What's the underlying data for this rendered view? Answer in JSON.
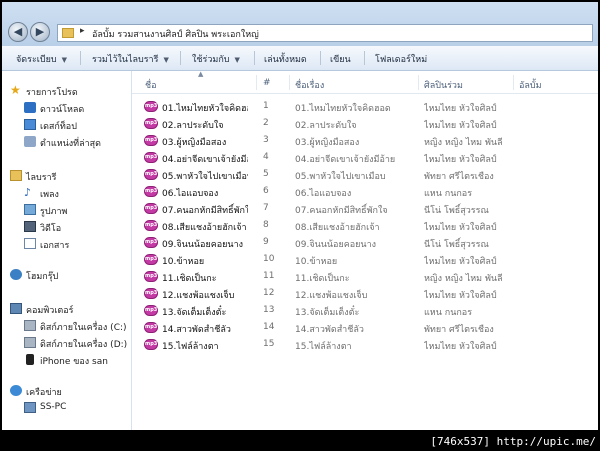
{
  "address": {
    "path": "อัลบั้ม รวมสานงานศิลป์ ศิลปิน พระเอกใหญ่"
  },
  "toolbar": {
    "organize": "จัดระเบียบ",
    "include_library": "รวมไว้ในไลบรารี",
    "share_with": "ใช้ร่วมกับ",
    "play_all": "เล่นทั้งหมด",
    "burn": "เขียน",
    "new_folder": "โฟลเดอร์ใหม่"
  },
  "nav": {
    "favorites": {
      "label": "รายการโปรด",
      "items": [
        "ดาวน์โหลด",
        "เดสก์ท็อป",
        "ตำแหน่งที่ล่าสุด"
      ]
    },
    "libraries": {
      "label": "ไลบรารี",
      "items": [
        "เพลง",
        "รูปภาพ",
        "วิดีโอ",
        "เอกสาร"
      ]
    },
    "homegroup": "โฮมกรุ๊ป",
    "computer": {
      "label": "คอมพิวเตอร์",
      "items": [
        "ดิสก์ภายในเครื่อง (C:)",
        "ดิสก์ภายในเครื่อง (D:)",
        "iPhone ของ san"
      ]
    },
    "network": {
      "label": "เครือข่าย",
      "items": [
        "SS-PC"
      ]
    }
  },
  "columns": {
    "name": "ชื่อ",
    "number": "#",
    "title": "ชื่อเรื่อง",
    "artist": "ศิลปินร่วม",
    "album": "อัลบั้ม"
  },
  "files": [
    {
      "name": "01.ไหมไทยหัวใจคิดฮอด",
      "num": "1",
      "title": "01.ไหมไทยหัวใจคิดฮอด",
      "artist": "ไหมไทย หัวใจศิลป์"
    },
    {
      "name": "02.ลาประดับใจ",
      "num": "2",
      "title": "02.ลาประดับใจ",
      "artist": "ไหมไทย หัวใจศิลป์"
    },
    {
      "name": "03.ผู้หญิงมือสอง",
      "num": "3",
      "title": "03.ผู้หญิงมือสอง",
      "artist": "หญิง หญิง ไหม พันลี"
    },
    {
      "name": "04.อย่าจีดเขาเจ้ายังมีอ้าย",
      "num": "4",
      "title": "04.อย่าจีดเขาเจ้ายังมีอ้าย",
      "artist": "ไหมไทย หัวใจศิลป์"
    },
    {
      "name": "05.พาหัวใจไปเขาเมือบ",
      "num": "5",
      "title": "05.พาหัวใจไปเขาเมือบ",
      "artist": "พัทยา ศรีไตรเชือง"
    },
    {
      "name": "06.ไอแอบจอง",
      "num": "6",
      "title": "06.ไอแอบจอง",
      "artist": "แหน กนกอร"
    },
    {
      "name": "07.คนอกหักมีสิทธิ์พักใจ",
      "num": "7",
      "title": "07.คนอกหักมีสิทธิ์พักใจ",
      "artist": "นีโน่ โพธิ์สุวรรณ"
    },
    {
      "name": "08.เสียแชงอ้ายฮักเจ้า",
      "num": "8",
      "title": "08.เสียแชงอ้ายฮักเจ้า",
      "artist": "ไหมไทย หัวใจศิลป์"
    },
    {
      "name": "09.จินนน้อยคอยนาง",
      "num": "9",
      "title": "09.จินนน้อยคอยนาง",
      "artist": "นีโน่ โพธิ์สุวรรณ"
    },
    {
      "name": "10.ข้าหอย",
      "num": "10",
      "title": "10.ข้าหอย",
      "artist": "ไหมไทย หัวใจศิลป์"
    },
    {
      "name": "11.เชิดเป็นกะ",
      "num": "11",
      "title": "11.เชิดเป็นกะ",
      "artist": "หญิง หญิง ไหม พันลี"
    },
    {
      "name": "12.แชงพ้อแชงเจ็บ",
      "num": "12",
      "title": "12.แชงพ้อแชงเจ็บ",
      "artist": "ไหมไทย หัวใจศิลป์"
    },
    {
      "name": "13.จัดเต็มเต็งตั๋ะ",
      "num": "13",
      "title": "13.จัดเต็มเต็งตั๋ะ",
      "artist": "แหน กนกอร"
    },
    {
      "name": "14.สาวพัดสำชีลัว",
      "num": "14",
      "title": "14.สาวพัดสำชีลัว",
      "artist": "พัทยา ศรีไตรเชือง"
    },
    {
      "name": "15.ไฟล์ล้างตา",
      "num": "15",
      "title": "15.ไฟล์ล้างตา",
      "artist": "ไหมไทย หัวใจศิลป์"
    }
  ],
  "watermark": "[746x537] http://upic.me/"
}
